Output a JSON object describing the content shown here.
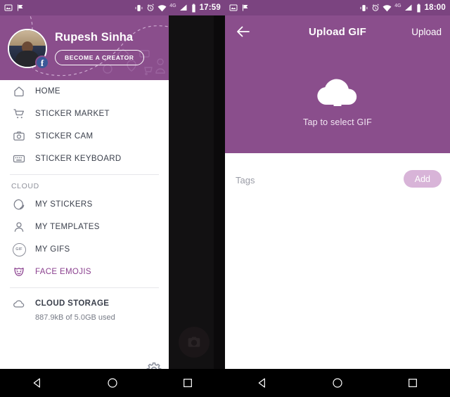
{
  "left": {
    "status_bar": {
      "time": "17:59",
      "network_label": "4G",
      "icons": [
        "image-notification-icon",
        "flag-notification-icon",
        "vibrate-icon",
        "alarm-icon",
        "wifi-icon",
        "signal-icon",
        "battery-icon"
      ]
    },
    "profile": {
      "name": "Rupesh Sinha",
      "creator_button": "BECOME A CREATOR",
      "facebook_badge": "f"
    },
    "menu": [
      {
        "label": "HOME",
        "icon": "home-icon",
        "active": false
      },
      {
        "label": "STICKER MARKET",
        "icon": "cart-icon",
        "active": false
      },
      {
        "label": "STICKER CAM",
        "icon": "camera-icon",
        "active": false
      },
      {
        "label": "STICKER KEYBOARD",
        "icon": "keyboard-icon",
        "active": false
      }
    ],
    "section_label": "CLOUD",
    "cloud_menu": [
      {
        "label": "MY STICKERS",
        "icon": "sticker-icon",
        "active": false
      },
      {
        "label": "MY TEMPLATES",
        "icon": "person-icon",
        "active": false
      },
      {
        "label": "MY GIFS",
        "icon": "gif-icon",
        "active": false
      },
      {
        "label": "FACE EMOJIS",
        "icon": "face-mask-icon",
        "active": true
      }
    ],
    "storage": {
      "label": "CLOUD STORAGE",
      "icon": "cloud-icon",
      "usage": "887.9kB of 5.0GB used"
    },
    "settings_icon": "gear-icon",
    "camera_shutter_icon": "camera-shutter-icon"
  },
  "right": {
    "status_bar": {
      "time": "18:00",
      "network_label": "4G",
      "icons": [
        "image-notification-icon",
        "flag-notification-icon",
        "vibrate-icon",
        "alarm-icon",
        "wifi-icon",
        "signal-icon",
        "battery-icon"
      ]
    },
    "appbar": {
      "back_icon": "arrow-back-icon",
      "title": "Upload GIF",
      "action": "Upload"
    },
    "hero": {
      "icon": "cloud-upload-icon",
      "label": "Tap to select GIF"
    },
    "tags": {
      "placeholder": "Tags",
      "add_button": "Add"
    }
  },
  "navbar": {
    "back": "nav-back-icon",
    "home": "nav-home-icon",
    "recents": "nav-recents-icon"
  },
  "colors": {
    "purple": "#8A4E8C",
    "purple_dark": "#7B4480",
    "accent_text": "#8A3F8E",
    "add_button": "#D8B4D8",
    "facebook": "#3B5998"
  }
}
